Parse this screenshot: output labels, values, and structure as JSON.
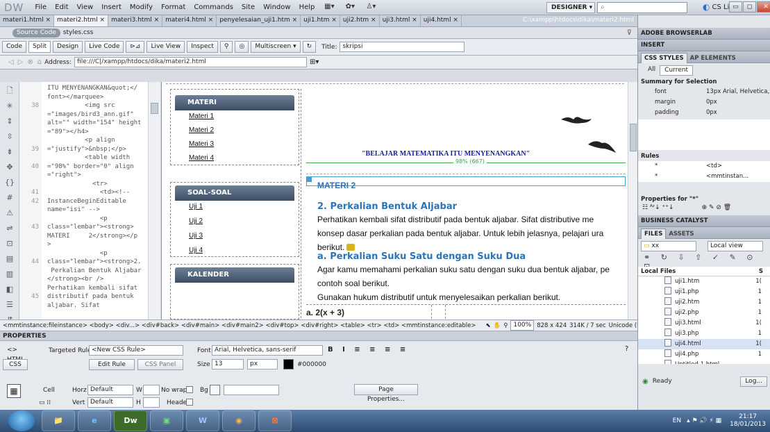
{
  "app": {
    "logo": "DW",
    "workspace": "DESIGNER ▾",
    "cs_live": "CS Live",
    "minimize": "▭",
    "maximize": "◻",
    "close": "✕"
  },
  "menu": [
    "File",
    "Edit",
    "View",
    "Insert",
    "Modify",
    "Format",
    "Commands",
    "Site",
    "Window",
    "Help"
  ],
  "menu_icons": [
    "▦▾",
    "✿▾",
    "♙▾"
  ],
  "tabs": [
    {
      "label": "materi1.html ×",
      "active": false
    },
    {
      "label": "materi2.html ×",
      "active": true
    },
    {
      "label": "materi3.html ×",
      "active": false
    },
    {
      "label": "materi4.html ×",
      "active": false
    },
    {
      "label": "penyelesaian_uji1.htm ×",
      "active": false
    },
    {
      "label": "uji1.htm ×",
      "active": false
    },
    {
      "label": "uji2.htm ×",
      "active": false
    },
    {
      "label": "uji3.html ×",
      "active": false
    },
    {
      "label": "uji4.html ×",
      "active": false
    }
  ],
  "tab_path": "C:\\xampp\\htdocs\\dika\\materi2.html",
  "related": {
    "source": "Source Code",
    "css": "styles.css"
  },
  "doc_toolbar": {
    "code": "Code",
    "split": "Split",
    "design": "Design",
    "live_code": "Live Code",
    "live_view": "Live View",
    "inspect": "Inspect",
    "multiscreen": "Multiscreen ▾",
    "title_label": "Title:",
    "title_value": "skripsi"
  },
  "address": {
    "label": "Address:",
    "value": "file:///C|/xampp/htdocs/dika/materi2.html"
  },
  "code": {
    "line_numbers": [
      "",
      "",
      "38",
      "",
      "",
      "",
      "",
      "39",
      "",
      "40",
      "",
      "",
      "41",
      "42",
      "",
      "",
      "43",
      "",
      "",
      "",
      "44",
      "",
      "",
      "",
      "45",
      "",
      ""
    ],
    "lines": [
      "ITU MENYENANGKAN&quot;</",
      "font></marquee>",
      "          <img src",
      "=\"images/bird3_ann.gif\"",
      "alt=\"\" width=\"154\" height",
      "=\"89\"></h4>",
      "          <p align",
      "=\"justify\">&nbsp;</p>",
      "          <table width",
      "=\"98%\" border=\"0\" align",
      "=\"right\">",
      "            <tr>",
      "              <td><!--",
      "InstanceBeginEditable",
      "name=\"isi\" -->",
      "              <p",
      "class=\"lembar\"><strong>",
      "MATERI     2</strong></p",
      ">",
      "              <p",
      "class=\"lembar\"><strong>2.",
      " Perkalian Bentuk Aljabar",
      "</strong><br />",
      "Perhatikan kembali sifat",
      "distributif pada bentuk",
      "aljabar. Sifat"
    ]
  },
  "design": {
    "nav_materi_title": "MATERI",
    "nav_materi": [
      "Materi 1",
      "Materi 2",
      "Materi 3",
      "Materi 4"
    ],
    "nav_soal_title": "SOAL-SOAL",
    "nav_soal": [
      "Uji 1",
      "Uji 2",
      "Uji 3",
      "Uji 4"
    ],
    "nav_kalender_title": "KALENDER",
    "marquee": "\"BELAJAR MATEMATIKA ITU MENYENANGKAN\"",
    "table_width": "98% (667)",
    "materi_title": "MATERI 2",
    "h2": "2. Perkalian Bentuk Aljabar",
    "p1": "Perhatikan kembali sifat distributif pada bentuk aljabar. Sifat distributive me",
    "p2": "konsep dasar perkalian pada bentuk aljabar. Untuk lebih jelasnya, pelajari ura",
    "p3": "berikut.",
    "h3": "a. Perkalian Suku Satu dengan Suku Dua",
    "p4": "Agar kamu memahami perkalian suku satu dengan suku dua bentuk aljabar, pe",
    "p5": "contoh soal berikut.",
    "p6": "Gunakan hukum distributif untuk menyelesaikan perkalian berikut.",
    "example": "a. 2(x + 3)"
  },
  "tag_selector": {
    "path": "<mmtinstance:fileinstance> <body> <div...> <div#back> <div#main> <div#main2> <div#top> <div#right> <table> <tr> <td> <mmtinstance:editable>",
    "zoom": "100%",
    "size": "828 x 424",
    "filesize": "314K / 7 sec",
    "encoding": "Unicode (UTF-8)"
  },
  "properties": {
    "title": "PROPERTIES",
    "html_btn": "<> HTML",
    "css_btn": "CSS",
    "targeted_rule_label": "Targeted Rule",
    "targeted_rule": "<New CSS Rule>",
    "edit_rule": "Edit Rule",
    "css_panel": "CSS Panel",
    "font_label": "Font",
    "font_value": "Arial, Helvetica, sans-serif",
    "size_label": "Size",
    "size_value": "13",
    "unit": "px",
    "color": "#000000",
    "cell_label": "Cell",
    "horz_label": "Horz",
    "horz_value": "Default",
    "vert_label": "Vert",
    "vert_value": "Default",
    "w_label": "W",
    "h_label": "H",
    "nowrap_label": "No wrap",
    "bg_label": "Bg",
    "header_label": "Header",
    "page_properties": "Page Properties..."
  },
  "rpanel": {
    "browserlab": "ADOBE BROWSERLAB",
    "insert": "INSERT",
    "css_styles": "CSS STYLES",
    "ap_elements": "AP ELEMENTS",
    "all": "All",
    "current": "Current",
    "summary": "Summary for Selection",
    "summary_rows": [
      {
        "k": "font",
        "v": "13px Arial, Helvetica, s..."
      },
      {
        "k": "margin",
        "v": "0px"
      },
      {
        "k": "padding",
        "v": "0px"
      }
    ],
    "rules": "Rules",
    "rules_rows": [
      {
        "k": "*",
        "v": "<td>"
      },
      {
        "k": "*",
        "v": "<mmtinstan..."
      }
    ],
    "props_for": "Properties for \"*\"",
    "business": "BUSINESS CATALYST",
    "files": "FILES",
    "assets": "ASSETS",
    "site": "xx",
    "view": "Local view",
    "local_files": "Local Files",
    "size_col": "S",
    "files_list": [
      {
        "name": "uji1.htm",
        "s": "1("
      },
      {
        "name": "uji1.php",
        "s": "1"
      },
      {
        "name": "uji2.htm",
        "s": "1"
      },
      {
        "name": "uji2.php",
        "s": "1"
      },
      {
        "name": "uji3.html",
        "s": "1("
      },
      {
        "name": "uji3.php",
        "s": "1"
      },
      {
        "name": "uji4.html",
        "s": "1("
      },
      {
        "name": "uji4.php",
        "s": "1"
      },
      {
        "name": "Untitled-1.html",
        "s": ""
      }
    ],
    "ready": "Ready",
    "log": "Log..."
  },
  "taskbar": {
    "apps": [
      "📁",
      "e",
      "Dw",
      "▣",
      "W",
      "◉",
      "⊠"
    ],
    "lang": "EN",
    "time": "21:17",
    "date": "18/01/2013"
  }
}
